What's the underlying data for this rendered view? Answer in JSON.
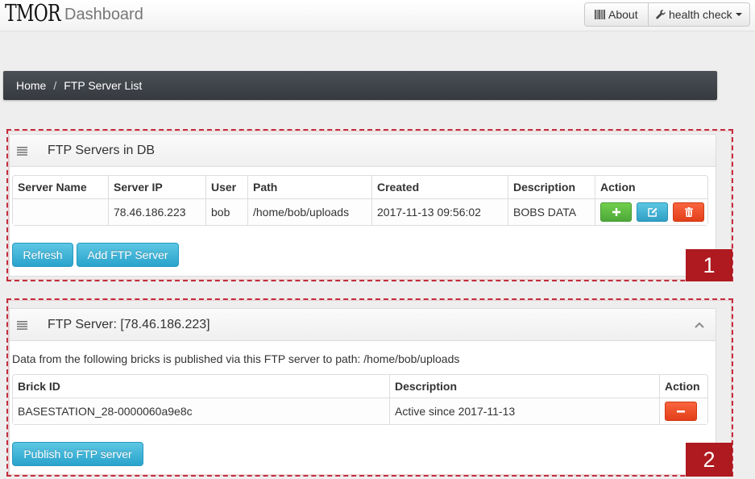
{
  "navbar": {
    "logo": "TMOR",
    "title": "Dashboard",
    "about": {
      "label": "About",
      "icon": "barcode-icon"
    },
    "health_check": {
      "label": "health check",
      "icon": "wrench-icon"
    }
  },
  "breadcrumb": {
    "items": [
      "Home",
      "FTP Server List"
    ],
    "separator": "/"
  },
  "ftp_servers_panel": {
    "title": "FTP Servers in DB",
    "icon": "list-icon",
    "table": {
      "columns": [
        "Server Name",
        "Server IP",
        "User",
        "Path",
        "Created",
        "Description",
        "Action"
      ],
      "rows": [
        {
          "server_name": "",
          "server_ip": "78.46.186.223",
          "user": "bob",
          "path": "/home/bob/uploads",
          "created": "2017-11-13 09:56:02",
          "description": "BOBS DATA",
          "actions": [
            "plus-icon",
            "edit-icon",
            "trash-icon"
          ]
        }
      ]
    },
    "refresh_label": "Refresh",
    "add_label": "Add FTP Server"
  },
  "ftp_server_detail_panel": {
    "title": "FTP Server: [78.46.186.223]",
    "icon": "list-icon",
    "collapse_icon": "chevron-up-icon",
    "info_text": "Data from the following bricks is published via this FTP server to path: /home/bob/uploads",
    "table": {
      "columns": [
        "Brick ID",
        "Description",
        "Action"
      ],
      "rows": [
        {
          "brick_id": "BASESTATION_28-0000060a9e8c",
          "description": "Active since 2017-11-13",
          "actions": [
            "minus-icon"
          ]
        }
      ]
    },
    "publish_label": "Publish to FTP server"
  },
  "annotations": [
    "1",
    "2"
  ],
  "colors": {
    "breadcrumb_bg": "#3d4146",
    "info_button": "#39b3d7",
    "success_button": "#5cb85c",
    "danger_button": "#ea4a22",
    "annotation": "#c42d3f",
    "annotation_badge": "#ae1a1f"
  }
}
